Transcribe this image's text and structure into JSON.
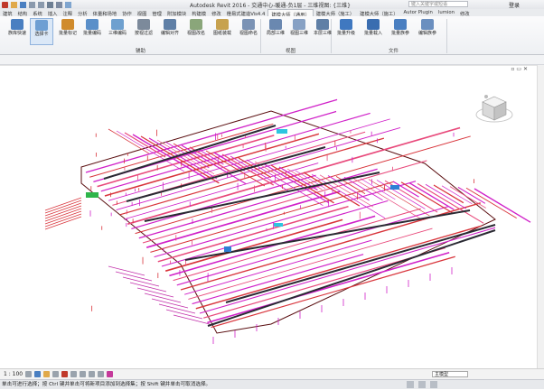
{
  "app": {
    "title": "Autodesk Revit 2016 -   交通中心-暖通-负1层 - 三维视图: {三维}",
    "search_placeholder": "键入关键字或短语",
    "login": "登录"
  },
  "tabs": [
    "建筑",
    "结构",
    "系统",
    "插入",
    "注释",
    "分析",
    "体量和场地",
    "协作",
    "视图",
    "管理",
    "附加模块",
    "构建模",
    "修改",
    "橙易式建造Vis4.4",
    "建模大师（通用）",
    "建模大师（施工）",
    "建模大师（施工）",
    "Autor Plugin",
    "lumion",
    "修改"
  ],
  "active_tab_index": 14,
  "ribbon": {
    "buttons": [
      {
        "label": "族库快速",
        "color": "#4a7fc1"
      },
      {
        "label": "选择卡",
        "color": "#6e9fd3",
        "selected": true
      },
      {
        "label": "批量标记",
        "color": "#d08b2c"
      },
      {
        "label": "批量编码",
        "color": "#5a8fc9"
      },
      {
        "label": "三维编码",
        "color": "#6fa0cf"
      },
      {
        "label": "按视过滤",
        "color": "#7c8a9b"
      },
      {
        "label": "编辑对齐",
        "color": "#5f7fa6"
      },
      {
        "label": "视图改名",
        "color": "#8aa67a"
      },
      {
        "label": "图纸装载",
        "color": "#c7a24f"
      },
      {
        "label": "视图命名",
        "color": "#7b93b5"
      },
      {
        "label": "局部三维",
        "color": "#6a88b0"
      },
      {
        "label": "视图三维",
        "color": "#87a1c4"
      },
      {
        "label": "本层三维",
        "color": "#5f7fa6"
      },
      {
        "label": "批量升级",
        "color": "#3f78c0"
      },
      {
        "label": "批量载入",
        "color": "#3a6db0"
      },
      {
        "label": "批量族参",
        "color": "#4a7fc1"
      },
      {
        "label": "编辑族参",
        "color": "#6b8fbf"
      }
    ],
    "groups": [
      "辅助",
      "视图",
      "文件"
    ]
  },
  "viewport": {
    "controls": "▫ ▭ ✕",
    "model_bg": "#ffffff"
  },
  "viewbar": {
    "scale": "1 : 100",
    "model": "主模型"
  },
  "statusbar": {
    "text": "单击可进行选择；按 Ctrl 键并单击可将新项目添加到选择集；按 Shift 键并单击可取消选择。"
  },
  "colors": {
    "duct_magenta": "#d020c8",
    "duct_red": "#d8333a",
    "pipe_dark": "#2a2a33",
    "accent_blue": "#2d7fd4",
    "accent_cyan": "#2cc5e0",
    "accent_green": "#2fb54a",
    "outline": "#5a0e10"
  }
}
